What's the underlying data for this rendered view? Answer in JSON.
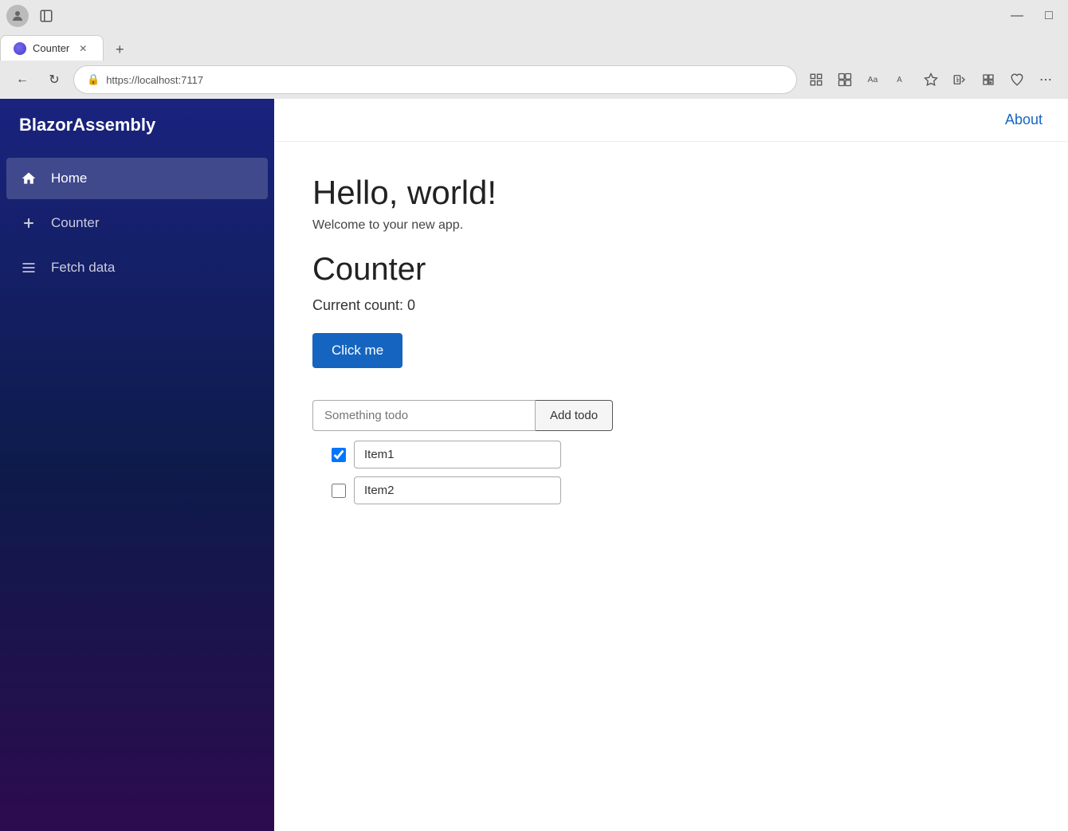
{
  "browser": {
    "tab_title": "Counter",
    "tab_favicon": "●",
    "new_tab_icon": "+",
    "close_icon": "✕",
    "url": "https://localhost:7117",
    "lock_icon": "🔒",
    "back_icon": "←",
    "refresh_icon": "↻",
    "minimize_icon": "—",
    "restore_icon": "□",
    "toolbar_icons": [
      "⊞",
      "⊟",
      "Aa",
      "A",
      "☆",
      "⧉",
      "★",
      "⊕",
      "♥",
      "⋯"
    ]
  },
  "sidebar": {
    "brand": "BlazorAssembly",
    "nav_items": [
      {
        "label": "Home",
        "icon": "🏠",
        "active": true
      },
      {
        "label": "Counter",
        "icon": "＋",
        "active": false
      },
      {
        "label": "Fetch data",
        "icon": "≡",
        "active": false
      }
    ]
  },
  "topbar": {
    "about_label": "About"
  },
  "content": {
    "hello_title": "Hello, world!",
    "welcome_text": "Welcome to your new app.",
    "counter_title": "Counter",
    "current_count_label": "Current count: 0",
    "click_button_label": "Click me",
    "todo_placeholder": "Something todo",
    "add_todo_label": "Add todo",
    "todo_items": [
      {
        "label": "Item1",
        "checked": true
      },
      {
        "label": "Item2",
        "checked": false
      }
    ]
  }
}
